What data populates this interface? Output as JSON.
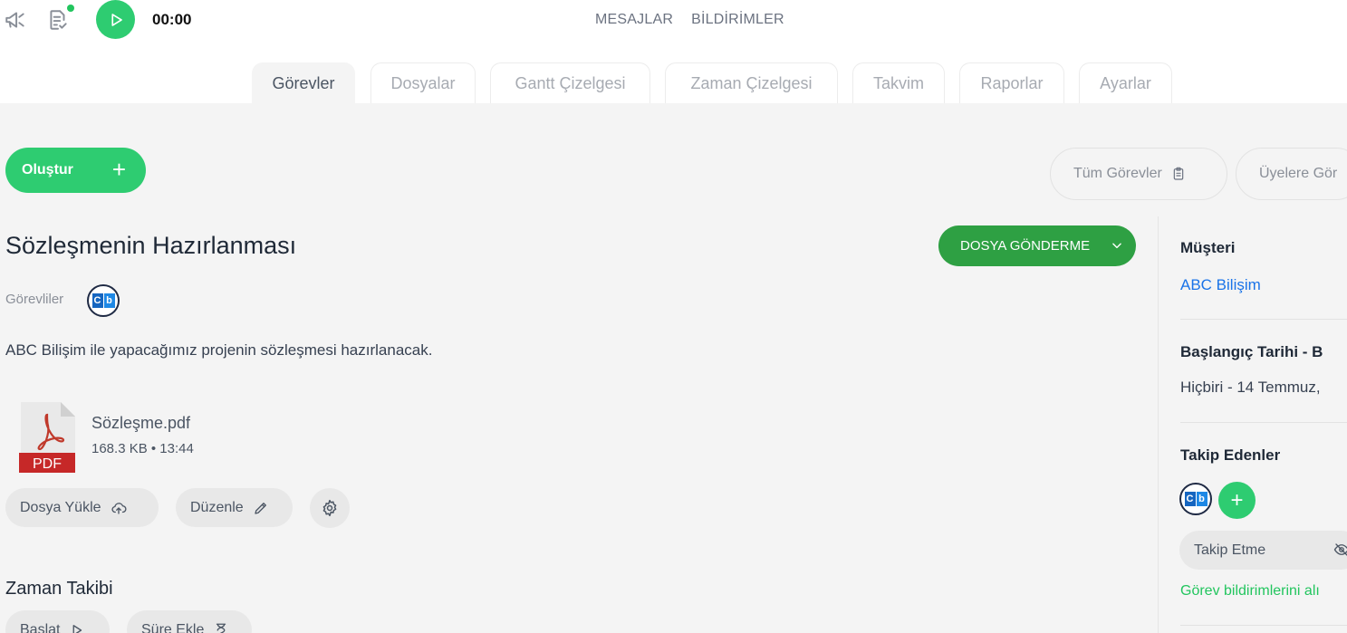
{
  "topbar": {
    "timer": "00:00",
    "links": [
      "MESAJLAR",
      "BİLDİRİMLER"
    ]
  },
  "tabs": [
    "Görevler",
    "Dosyalar",
    "Gantt Çizelgesi",
    "Zaman Çizelgesi",
    "Takvim",
    "Raporlar",
    "Ayarlar"
  ],
  "toolbar": {
    "create_label": "Oluştur",
    "filters": [
      "Tüm Görevler",
      "Üyelere Gör"
    ]
  },
  "task": {
    "title": "Sözleşmenin Hazırlanması",
    "status": "DOSYA GÖNDERME",
    "assignees_label": "Görevliler",
    "description": "ABC Bilişim ile yapacağımız projenin sözleşmesi hazırlanacak.",
    "attachment": {
      "type_label": "PDF",
      "name": "Sözleşme.pdf",
      "meta": "168.3 KB • 13:44"
    },
    "actions": {
      "upload": "Dosya Yükle",
      "edit": "Düzenle"
    },
    "time_tracking": {
      "title": "Zaman Takibi",
      "start": "Başlat",
      "add_time": "Süre Ekle"
    }
  },
  "sidebar": {
    "customer_heading": "Müşteri",
    "customer_value": "ABC Bilişim",
    "dates_heading": "Başlangıç Tarihi - B",
    "dates_value": "Hiçbiri - 14 Temmuz,",
    "followers_heading": "Takip Edenler",
    "unfollow_label": "Takip Etme",
    "notify_text": "Görev bildirimlerini alı"
  },
  "colors": {
    "green": "#2ecc71",
    "status_green": "#2ea043",
    "link_blue": "#1a73e8",
    "notify_green": "#22c55e"
  }
}
